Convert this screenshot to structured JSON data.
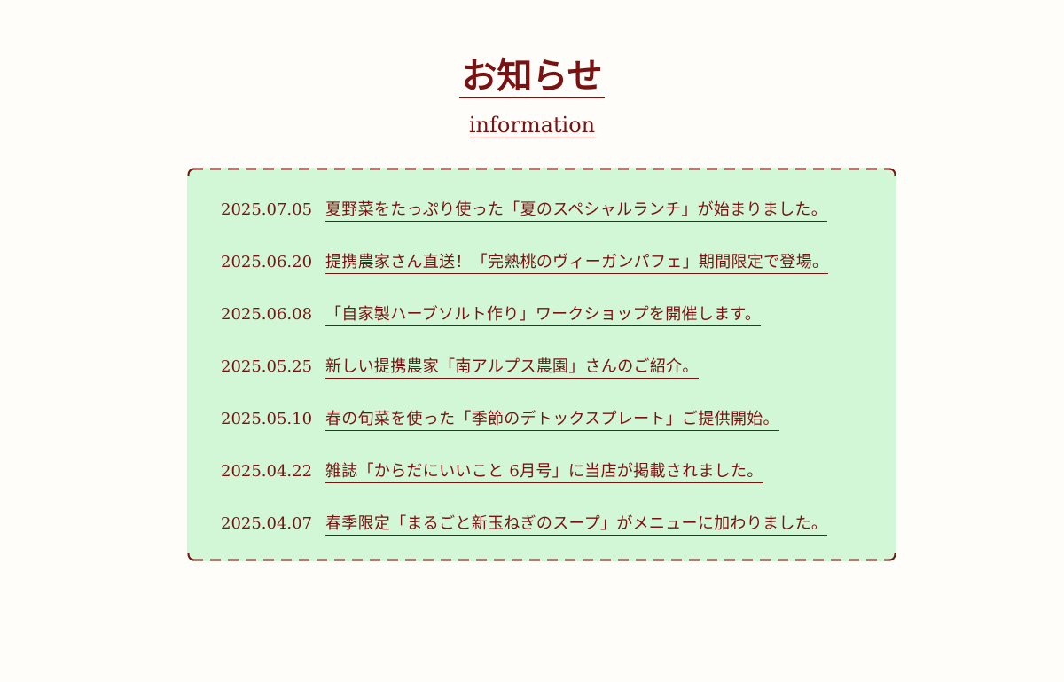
{
  "header": {
    "title": "お知らせ",
    "subtitle": "information"
  },
  "colors": {
    "accent": "#7a1212",
    "box_background": "#d2f7d6",
    "page_background": "#fffdfa"
  },
  "news": [
    {
      "date": "2025.07.05",
      "text": "夏野菜をたっぷり使った「夏のスペシャルランチ」が始まりました。"
    },
    {
      "date": "2025.06.20",
      "text": "提携農家さん直送！「完熟桃のヴィーガンパフェ」期間限定で登場。"
    },
    {
      "date": "2025.06.08",
      "text": "「自家製ハーブソルト作り」ワークショップを開催します。"
    },
    {
      "date": "2025.05.25",
      "text": "新しい提携農家「南アルプス農園」さんのご紹介。"
    },
    {
      "date": "2025.05.10",
      "text": "春の旬菜を使った「季節のデトックスプレート」ご提供開始。"
    },
    {
      "date": "2025.04.22",
      "text": "雑誌「からだにいいこと 6月号」に当店が掲載されました。"
    },
    {
      "date": "2025.04.07",
      "text": "春季限定「まるごと新玉ねぎのスープ」がメニューに加わりました。"
    }
  ]
}
